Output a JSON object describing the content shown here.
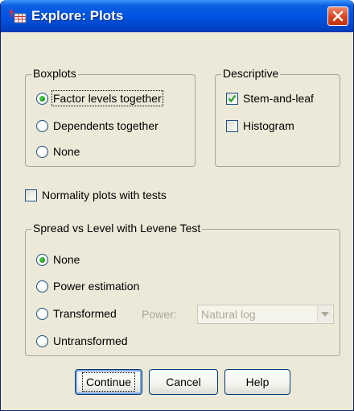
{
  "window": {
    "title": "Explore: Plots"
  },
  "boxplots": {
    "legend": "Boxplots",
    "options": [
      {
        "label": "Factor levels together",
        "selected": true
      },
      {
        "label": "Dependents together",
        "selected": false
      },
      {
        "label": "None",
        "selected": false
      }
    ]
  },
  "descriptive": {
    "legend": "Descriptive",
    "options": [
      {
        "label": "Stem-and-leaf",
        "checked": true
      },
      {
        "label": "Histogram",
        "checked": false
      }
    ]
  },
  "normality": {
    "label": "Normality plots with tests",
    "checked": false
  },
  "spread": {
    "legend": "Spread vs Level with Levene Test",
    "options": [
      {
        "label": "None",
        "selected": true
      },
      {
        "label": "Power estimation",
        "selected": false
      },
      {
        "label": "Transformed",
        "selected": false
      },
      {
        "label": "Untransformed",
        "selected": false
      }
    ],
    "power_label": "Power:",
    "power_value": "Natural log"
  },
  "buttons": {
    "continue": "Continue",
    "cancel": "Cancel",
    "help": "Help"
  },
  "colors": {
    "titlebar": "#0054e3",
    "dialog_bg": "#ece9d8",
    "radio_selected": "#21a121"
  }
}
